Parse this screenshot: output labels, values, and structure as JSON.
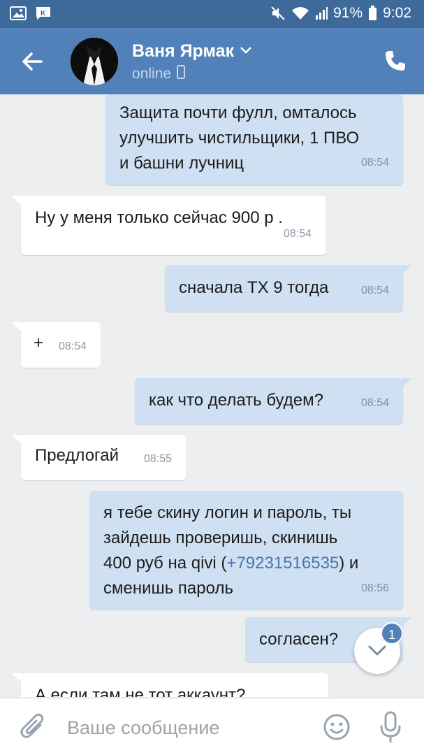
{
  "status_bar": {
    "battery": "91%",
    "time": "9:02",
    "icons": [
      "gallery-icon",
      "vk-notification-icon",
      "mute-icon",
      "wifi-icon",
      "signal-icon",
      "battery-icon"
    ]
  },
  "header": {
    "name": "Ваня Ярмак",
    "status": "online",
    "icons": [
      "back-arrow-icon",
      "chevron-down-icon",
      "mobile-device-icon",
      "phone-icon"
    ]
  },
  "messages": [
    {
      "dir": "out",
      "lines": [
        "Защита почти фулл, омталось",
        "улучшить чистильщики, 1 ПВО",
        "и башни лучниц"
      ],
      "time": "08:54"
    },
    {
      "dir": "in",
      "text": "Ну у меня только сейчас 900 р .",
      "time": "08:54"
    },
    {
      "dir": "out",
      "text": "сначала ТХ 9 тогда",
      "time": "08:54"
    },
    {
      "dir": "in",
      "text": "+",
      "time": "08:54"
    },
    {
      "dir": "out",
      "text": "как что делать будем?",
      "time": "08:54"
    },
    {
      "dir": "in",
      "text": "Предлогай",
      "time": "08:55"
    },
    {
      "dir": "out",
      "line1": "я тебе скину логин и пароль, ты",
      "line2": "зайдешь проверишь, скинишь",
      "line3_pre": "400 руб на qivi (",
      "line3_link": "+79231516535",
      "line3_post": ") и",
      "line4": "сменишь пароль",
      "time": "08:56"
    },
    {
      "dir": "out",
      "text": "согласен?",
      "time": ""
    },
    {
      "dir": "in",
      "text": "А если там не тот аккаунт?",
      "time": ""
    }
  ],
  "scroll_button": {
    "badge": "1",
    "icon": "chevron-down-icon"
  },
  "composer": {
    "placeholder": "Ваше сообщение",
    "icons": [
      "attach-icon",
      "emoji-icon",
      "microphone-icon"
    ]
  },
  "colors": {
    "status_bar": "#3d6a99",
    "header": "#5181b8",
    "chat_bg": "#edeef0",
    "outgoing_bubble": "#cfe0f2",
    "incoming_bubble": "#ffffff",
    "link": "#4a76a8"
  }
}
